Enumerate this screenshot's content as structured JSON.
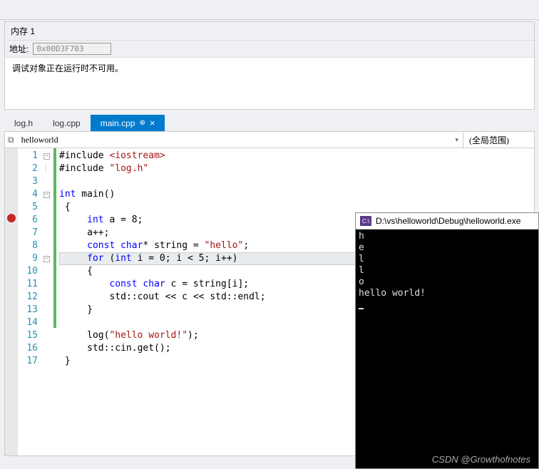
{
  "memory": {
    "title": "内存 1",
    "address_label": "地址:",
    "address_value": "0x00D3F703",
    "message": "调试对象正在运行时不可用。"
  },
  "tabs": [
    {
      "label": "log.h",
      "active": false
    },
    {
      "label": "log.cpp",
      "active": false
    },
    {
      "label": "main.cpp",
      "active": true
    }
  ],
  "nav": {
    "left": "helloworld",
    "right": "(全局范围)"
  },
  "code": {
    "lines": [
      {
        "n": 1,
        "fold": "minus",
        "change": true,
        "html": "#include <span class='inc'>&lt;iostream&gt;</span>"
      },
      {
        "n": 2,
        "fold": "pipe",
        "change": true,
        "html": "#include <span class='inc'>\"log.h\"</span>"
      },
      {
        "n": 3,
        "fold": "",
        "change": true,
        "html": ""
      },
      {
        "n": 4,
        "fold": "minus",
        "change": true,
        "html": "<span class='kw'>int</span> main()"
      },
      {
        "n": 5,
        "fold": "",
        "change": true,
        "html": " {"
      },
      {
        "n": 6,
        "fold": "",
        "change": true,
        "bp": true,
        "html": "     <span class='kw'>int</span> a = 8;"
      },
      {
        "n": 7,
        "fold": "",
        "change": true,
        "html": "     a++;"
      },
      {
        "n": 8,
        "fold": "",
        "change": true,
        "html": "     <span class='kw'>const</span> <span class='kw'>char</span>* string = <span class='str'>\"hello\"</span>;"
      },
      {
        "n": 9,
        "fold": "minus",
        "change": true,
        "current": true,
        "html": "     <span class='kw'>for</span> (<span class='kw'>int</span> i = 0; i &lt; 5; i++)"
      },
      {
        "n": 10,
        "fold": "",
        "change": true,
        "html": "     {"
      },
      {
        "n": 11,
        "fold": "",
        "change": true,
        "html": "         <span class='kw'>const</span> <span class='kw'>char</span> c = string[i];"
      },
      {
        "n": 12,
        "fold": "",
        "change": true,
        "html": "         std::cout &lt;&lt; c &lt;&lt; std::endl;"
      },
      {
        "n": 13,
        "fold": "",
        "change": true,
        "html": "     }"
      },
      {
        "n": 14,
        "fold": "",
        "change": true,
        "html": ""
      },
      {
        "n": 15,
        "fold": "",
        "change": false,
        "html": "     log(<span class='str'>\"hello world!\"</span>);"
      },
      {
        "n": 16,
        "fold": "",
        "change": false,
        "html": "     std::cin.get();"
      },
      {
        "n": 17,
        "fold": "",
        "change": false,
        "html": " }"
      }
    ]
  },
  "console": {
    "title": "D:\\vs\\helloworld\\Debug\\helloworld.exe",
    "icon_text": "C:\\",
    "output": [
      "h",
      "e",
      "l",
      "l",
      "o",
      "hello world!"
    ]
  },
  "watermark": "CSDN @Growthofnotes"
}
